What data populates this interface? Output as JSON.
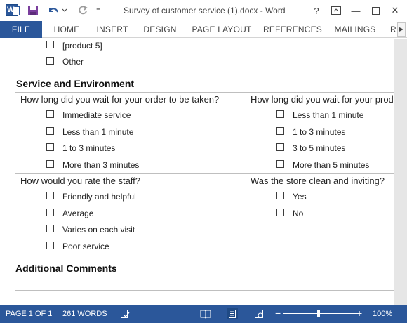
{
  "window": {
    "title": "Survey of customer service (1).docx - Word",
    "help": "?",
    "minimize": "—",
    "close": "✕",
    "qat_more": "⁼"
  },
  "ribbon": {
    "tabs": [
      "FILE",
      "HOME",
      "INSERT",
      "DESIGN",
      "PAGE LAYOUT",
      "REFERENCES",
      "MAILINGS",
      "R"
    ],
    "scroll": "▶"
  },
  "document": {
    "top_options": [
      "[product 5]",
      "Other"
    ],
    "section_service": "Service and Environment",
    "q_wait_taken": "How long did you wait for your order to be taken?",
    "q_wait_taken_options": [
      "Immediate service",
      "Less than 1 minute",
      "1 to 3 minutes",
      "More than 3 minutes"
    ],
    "q_wait_product": "How long did you wait for your product?",
    "q_wait_product_options": [
      "Less than 1 minute",
      "1 to 3 minutes",
      "3 to 5 minutes",
      "More than 5 minutes"
    ],
    "q_staff": "How would you rate the staff?",
    "q_staff_options": [
      "Friendly and helpful",
      "Average",
      "Varies on each visit",
      "Poor service"
    ],
    "q_clean": "Was the store clean and inviting?",
    "q_clean_options": [
      "Yes",
      "No"
    ],
    "section_comments": "Additional Comments"
  },
  "status": {
    "page": "PAGE 1 OF 1",
    "words": "261 WORDS",
    "zoom_minus": "−",
    "zoom_plus": "+",
    "zoom_level": "100%",
    "zoom_fraction": 0.5
  },
  "colors": {
    "accent": "#2b579a"
  },
  "icons": {
    "app": "word-icon",
    "save": "save-icon",
    "undo": "undo-icon",
    "redo": "redo-icon",
    "proofing": "proofing-icon",
    "read_mode": "read-mode-icon",
    "print_layout": "print-layout-icon",
    "web_layout": "web-layout-icon"
  }
}
